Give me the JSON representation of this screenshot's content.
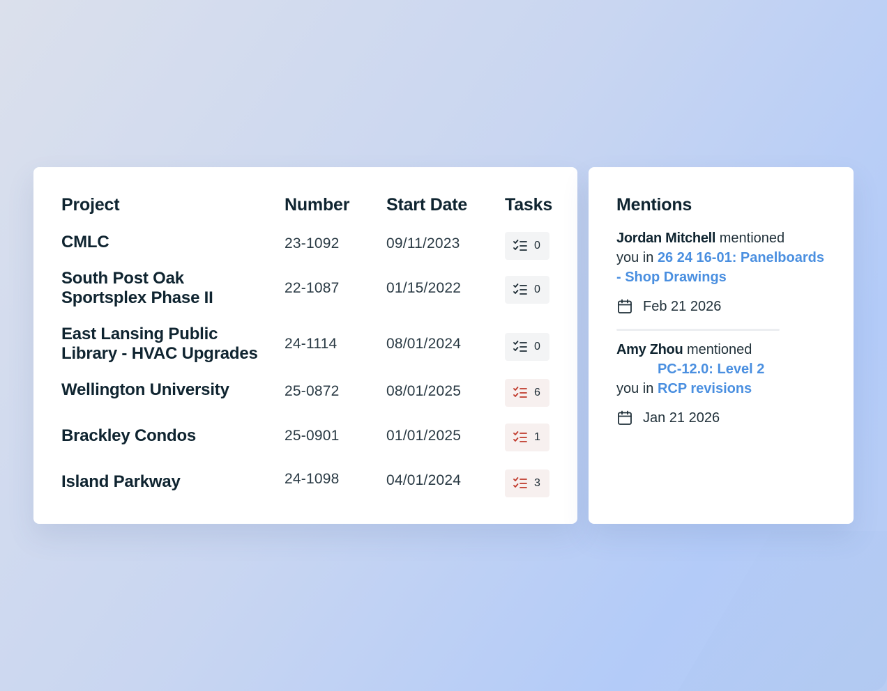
{
  "projects": {
    "headers": {
      "project": "Project",
      "number": "Number",
      "start_date": "Start Date",
      "tasks": "Tasks"
    },
    "rows": [
      {
        "name": "CMLC",
        "number": "23-1092",
        "start_date": "09/11/2023",
        "tasks": "0",
        "alert": false
      },
      {
        "name": "South Post Oak Sportsplex Phase II",
        "number": "22-1087",
        "start_date": "01/15/2022",
        "tasks": "0",
        "alert": false
      },
      {
        "name": "East Lansing Public Library - HVAC Upgrades",
        "number": "24-1114",
        "start_date": "08/01/2024",
        "tasks": "0",
        "alert": false
      },
      {
        "name": "Wellington University",
        "number": "25-0872",
        "start_date": "08/01/2025",
        "tasks": "6",
        "alert": true
      },
      {
        "name": "Brackley Condos",
        "number": "25-0901",
        "start_date": "01/01/2025",
        "tasks": "1",
        "alert": true
      },
      {
        "name": "Island Parkway",
        "number": "24-1098",
        "start_date": "04/01/2024",
        "tasks": "3",
        "alert": true
      }
    ],
    "icon": "task-checklist-icon",
    "colors": {
      "normal_icon": "#1b2a33",
      "alert_icon": "#c0392b"
    }
  },
  "mentions": {
    "title": "Mentions",
    "items": [
      {
        "user": "Jordan Mitchell",
        "verb": "mentioned",
        "prefix": "you in",
        "link": "26 24 16-01: Panelboards - Shop Drawings",
        "date": "Feb 21 2026"
      },
      {
        "user": "Amy Zhou",
        "verb": "mentioned",
        "prefix": "you in",
        "link": "PC-12.0: Level 2 RCP revisions",
        "date": "Jan 21 2026"
      }
    ],
    "date_icon": "calendar-icon",
    "colors": {
      "link": "#4a8fe0"
    }
  }
}
